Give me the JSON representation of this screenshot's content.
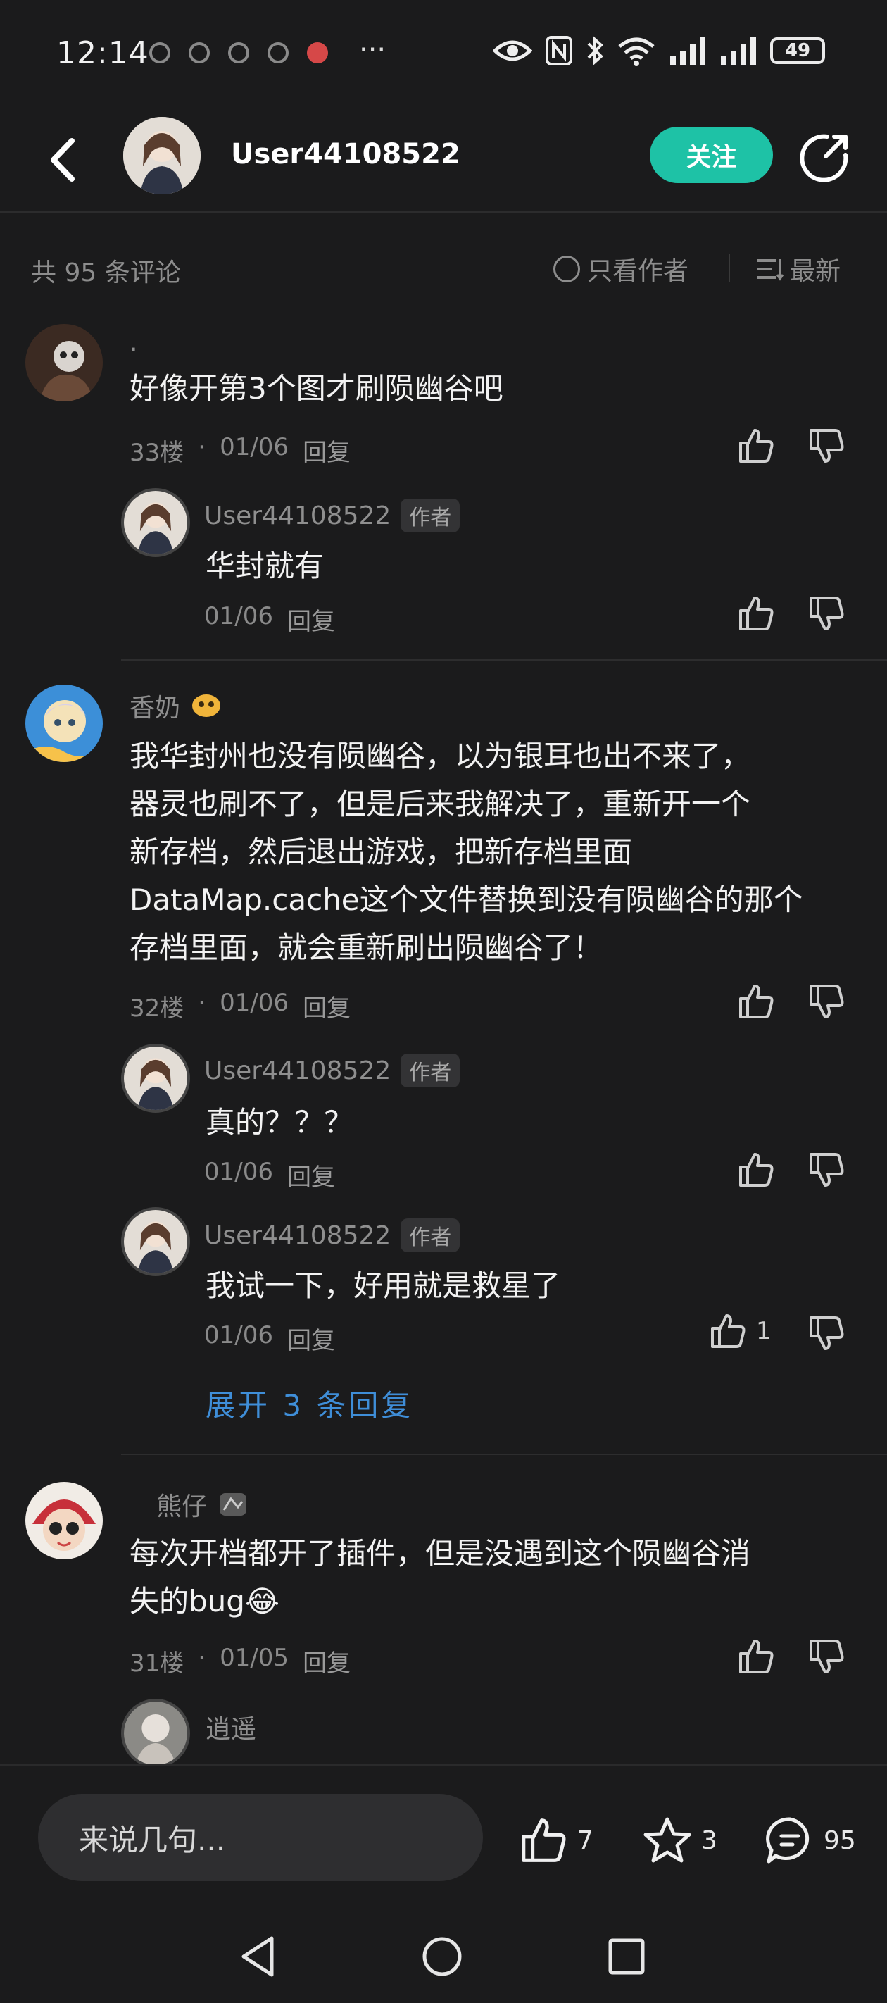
{
  "status": {
    "time": "12:14",
    "more": "···",
    "battery": "49"
  },
  "header": {
    "username": "User44108522",
    "follow_label": "关注"
  },
  "filter": {
    "count": "共 95 条评论",
    "only_author": "只看作者",
    "sort": "最新"
  },
  "comments": [
    {
      "name": ".",
      "text": "好像开第3个图才刷陨幽谷吧",
      "floor": "33楼",
      "date": "01/06",
      "reply_label": "回复",
      "replies": [
        {
          "name": "User44108522",
          "tag": "作者",
          "text": "华封就有",
          "date": "01/06",
          "reply_label": "回复"
        }
      ]
    },
    {
      "name": "香奶",
      "text_lines": [
        "我华封州也没有陨幽谷，以为银耳也出不来了，",
        "器灵也刷不了，但是后来我解决了，重新开一个",
        "新存档，然后退出游戏，把新存档里面",
        "DataMap.cache这个文件替换到没有陨幽谷的那个",
        "存档里面，就会重新刷出陨幽谷了！"
      ],
      "floor": "32楼",
      "date": "01/06",
      "reply_label": "回复",
      "replies": [
        {
          "name": "User44108522",
          "tag": "作者",
          "text": "真的？？？",
          "date": "01/06",
          "reply_label": "回复"
        },
        {
          "name": "User44108522",
          "tag": "作者",
          "text": "我试一下，好用就是救星了",
          "date": "01/06",
          "reply_label": "回复",
          "likes": "1"
        }
      ],
      "expand_label": "展开 3 条回复"
    },
    {
      "name": "熊仔",
      "text_lines": [
        "每次开档都开了插件，但是没遇到这个陨幽谷消",
        "失的bug😂"
      ],
      "floor": "31楼",
      "date": "01/05",
      "reply_label": "回复",
      "replies": [
        {
          "name": "逍遥"
        }
      ]
    }
  ],
  "bottom": {
    "input_placeholder": "来说几句...",
    "likes": "7",
    "favorites": "3",
    "comments": "95"
  }
}
